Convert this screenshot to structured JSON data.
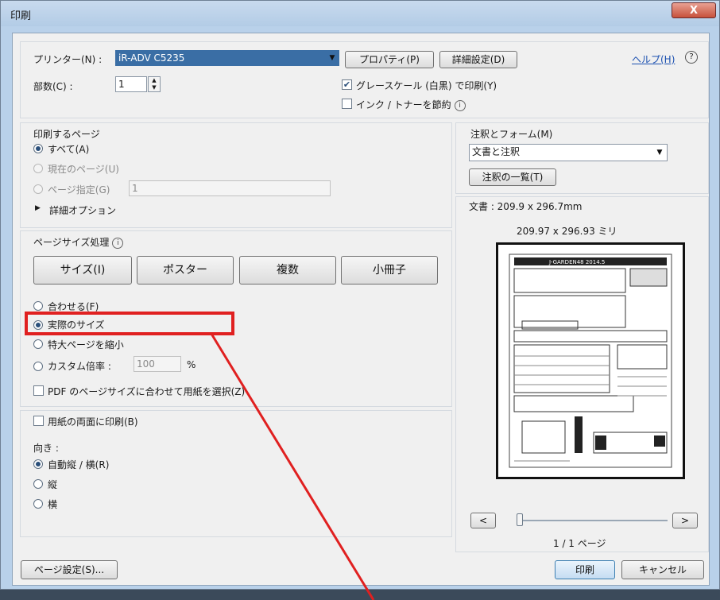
{
  "window": {
    "title": "印刷",
    "close_label": "X"
  },
  "printer": {
    "label": "プリンター(N) :",
    "selected": "iR-ADV C5235",
    "properties_button": "プロパティ(P)",
    "advanced_button": "詳細設定(D)",
    "help_link": "ヘルプ(H)",
    "help_icon": "?"
  },
  "copies": {
    "label": "部数(C) :",
    "value": "1"
  },
  "options": {
    "grayscale": {
      "label": "グレースケール (白黒) で印刷(Y)",
      "checked": true
    },
    "save_ink": {
      "label": "インク / トナーを節約",
      "checked": false,
      "info": "i"
    }
  },
  "pages_to_print": {
    "title": "印刷するページ",
    "all": "すべて(A)",
    "current": "現在のページ(U)",
    "pages": "ページ指定(G)",
    "pages_value": "1",
    "more_options": "詳細オプション"
  },
  "page_sizing": {
    "title": "ページサイズ処理",
    "info": "i",
    "tabs": [
      "サイズ(I)",
      "ポスター",
      "複数",
      "小冊子"
    ],
    "fit": "合わせる(F)",
    "actual_size": "実際のサイズ",
    "shrink": "特大ページを縮小",
    "custom_scale": "カスタム倍率 :",
    "custom_value": "100",
    "percent": "%",
    "choose_paper": "PDF のページサイズに合わせて用紙を選択(Z)"
  },
  "duplex": {
    "label": "用紙の両面に印刷(B)"
  },
  "orientation": {
    "title": "向き :",
    "auto": "自動縦 / 横(R)",
    "portrait": "縦",
    "landscape": "横"
  },
  "comments_forms": {
    "title": "注釈とフォーム(M)",
    "selected": "文書と注釈",
    "summarize_button": "注釈の一覧(T)"
  },
  "preview": {
    "doc_size": "文書 : 209.9 x 296.7mm",
    "page_size": "209.97 x 296.93 ミリ",
    "header_text": "J-GARDEN48 2014.5",
    "prev": "<",
    "next": ">",
    "page_indicator": "1 / 1 ページ"
  },
  "footer": {
    "page_setup": "ページ設定(S)...",
    "print": "印刷",
    "cancel": "キャンセル"
  },
  "colors": {
    "highlight": "#e02020",
    "selection": "#3a6ea5"
  }
}
